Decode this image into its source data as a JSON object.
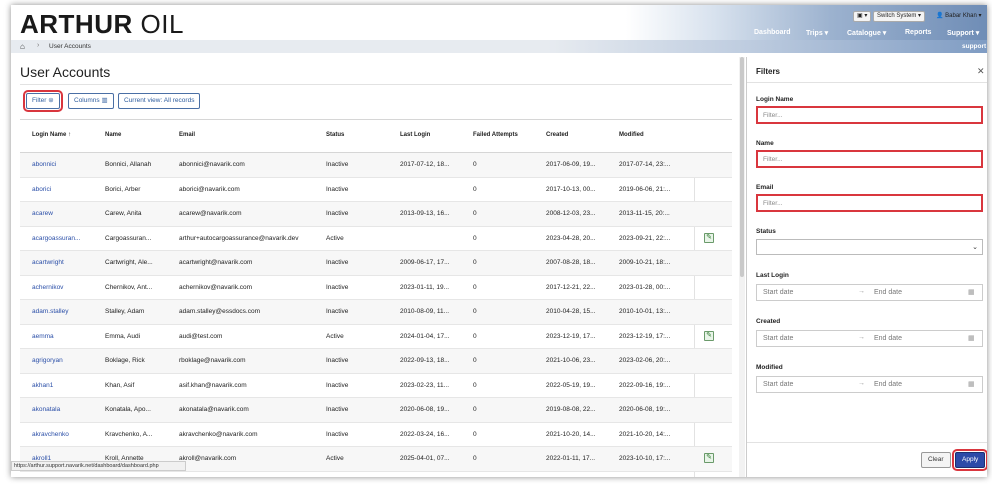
{
  "brand": {
    "logo_bold": "ARTHUR",
    "logo_light": "OIL"
  },
  "header": {
    "switch_system": "Switch System",
    "user": "Babar Khan",
    "nav": [
      "Dashboard",
      "Trips",
      "Catalogue",
      "Reports",
      "Support"
    ]
  },
  "breadcrumb": {
    "current": "User Accounts",
    "right": "support"
  },
  "page": {
    "title": "User Accounts"
  },
  "toolbar": {
    "filter": "Filter",
    "columns": "Columns",
    "view": "Current view: All records"
  },
  "table": {
    "columns": [
      "Login Name",
      "Name",
      "Email",
      "Status",
      "Last Login",
      "Failed Attempts",
      "Created",
      "Modified"
    ],
    "rows": [
      {
        "login": "abonnici",
        "name": "Bonnici, Allanah",
        "email": "abonnici@navarik.com",
        "status": "Inactive",
        "last": "2017-07-12, 18...",
        "failed": "0",
        "created": "2017-06-09, 19...",
        "modified": "2017-07-14, 23:...",
        "edit": false
      },
      {
        "login": "aborici",
        "name": "Borici, Arber",
        "email": "aborici@navarik.com",
        "status": "Inactive",
        "last": "",
        "failed": "0",
        "created": "2017-10-13, 00...",
        "modified": "2019-06-06, 21:...",
        "edit": false
      },
      {
        "login": "acarew",
        "name": "Carew, Anita",
        "email": "acarew@navarik.com",
        "status": "Inactive",
        "last": "2013-09-13, 16...",
        "failed": "0",
        "created": "2008-12-03, 23...",
        "modified": "2013-11-15, 20:...",
        "edit": false
      },
      {
        "login": "acargoassuran...",
        "name": "Cargoassuran...",
        "email": "arthur+autocargoassurance@navarik.dev",
        "status": "Active",
        "last": "",
        "failed": "0",
        "created": "2023-04-28, 20...",
        "modified": "2023-09-21, 22:...",
        "edit": true
      },
      {
        "login": "acartwright",
        "name": "Cartwright, Ale...",
        "email": "acartwright@navarik.com",
        "status": "Inactive",
        "last": "2009-06-17, 17...",
        "failed": "0",
        "created": "2007-08-28, 18...",
        "modified": "2009-10-21, 18:...",
        "edit": false
      },
      {
        "login": "achernikov",
        "name": "Chernikov, Ant...",
        "email": "achernikov@navarik.com",
        "status": "Inactive",
        "last": "2023-01-11, 19...",
        "failed": "0",
        "created": "2017-12-21, 22...",
        "modified": "2023-01-28, 00:...",
        "edit": false
      },
      {
        "login": "adam.stalley",
        "name": "Stalley, Adam",
        "email": "adam.stalley@essdocs.com",
        "status": "Inactive",
        "last": "2010-08-09, 11...",
        "failed": "0",
        "created": "2010-04-28, 15...",
        "modified": "2010-10-01, 13:...",
        "edit": false
      },
      {
        "login": "aemma",
        "name": "Emma, Audi",
        "email": "audi@test.com",
        "status": "Active",
        "last": "2024-01-04, 17...",
        "failed": "0",
        "created": "2023-12-19, 17...",
        "modified": "2023-12-19, 17:...",
        "edit": true
      },
      {
        "login": "agrigoryan",
        "name": "Boklage, Rick",
        "email": "rboklage@navarik.com",
        "status": "Inactive",
        "last": "2022-09-13, 18...",
        "failed": "0",
        "created": "2021-10-06, 23...",
        "modified": "2023-02-06, 20:...",
        "edit": false
      },
      {
        "login": "akhan1",
        "name": "Khan, Asif",
        "email": "asif.khan@navarik.com",
        "status": "Inactive",
        "last": "2023-02-23, 11...",
        "failed": "0",
        "created": "2022-05-19, 19...",
        "modified": "2022-09-16, 19:...",
        "edit": false
      },
      {
        "login": "akonatala",
        "name": "Konatala, Apo...",
        "email": "akonatala@navarik.com",
        "status": "Inactive",
        "last": "2020-06-08, 19...",
        "failed": "0",
        "created": "2019-08-08, 22...",
        "modified": "2020-06-08, 19:...",
        "edit": false
      },
      {
        "login": "akravchenko",
        "name": "Kravchenko, A...",
        "email": "akravchenko@navarik.com",
        "status": "Inactive",
        "last": "2022-03-24, 16...",
        "failed": "0",
        "created": "2021-10-20, 14...",
        "modified": "2021-10-20, 14:...",
        "edit": false
      },
      {
        "login": "akroll1",
        "name": "Kroll, Annette",
        "email": "akroll@navarik.com",
        "status": "Active",
        "last": "2025-04-01, 07...",
        "failed": "0",
        "created": "2022-01-11, 17...",
        "modified": "2023-10-10, 17:...",
        "edit": true
      }
    ]
  },
  "status_bar": "https://arthur.support.navarik.net/dashboard/dashboard.php",
  "filters": {
    "title": "Filters",
    "login_label": "Login Name",
    "login_placeholder": "Filter...",
    "name_label": "Name",
    "name_placeholder": "Filter...",
    "email_label": "Email",
    "email_placeholder": "Filter...",
    "status_label": "Status",
    "last_login_label": "Last Login",
    "created_label": "Created",
    "modified_label": "Modified",
    "start_date": "Start date",
    "end_date": "End date",
    "clear": "Clear",
    "apply": "Apply"
  }
}
